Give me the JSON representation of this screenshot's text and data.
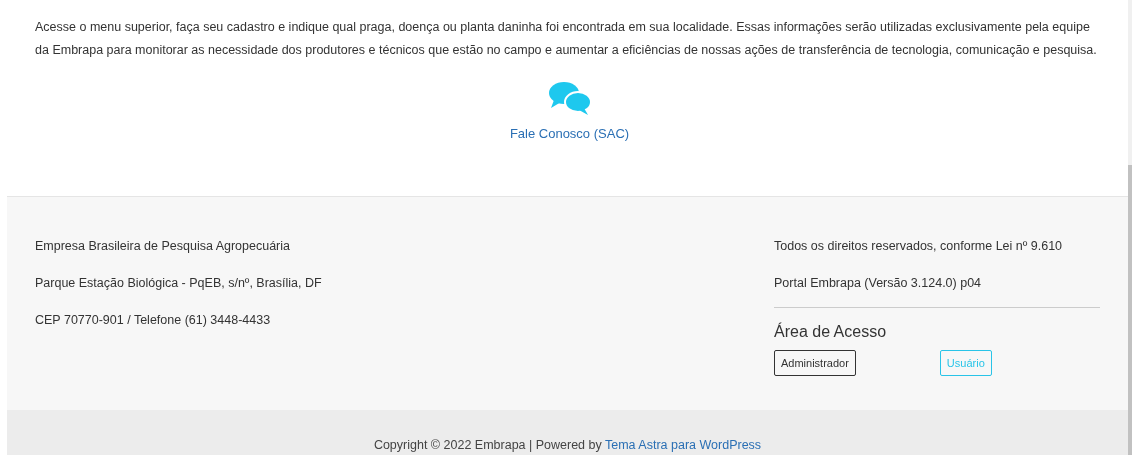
{
  "intro": {
    "paragraph": "Acesse o menu superior, faça seu cadastro e indique qual praga, doença ou planta daninha foi encontrada em sua localidade. Essas informações serão utilizadas exclusivamente pela equipe da Embrapa para monitorar as necessidade dos produtores e técnicos que estão no campo e aumentar a eficiências de nossas ações de transferência de tecnologia, comunicação e pesquisa.",
    "contact_link": "Fale Conosco (SAC)"
  },
  "footer": {
    "left_lines": [
      "Empresa Brasileira de Pesquisa Agropecuária",
      "Parque Estação Biológica - PqEB, s/nº, Brasília, DF",
      "CEP 70770-901 / Telefone (61) 3448-4433"
    ],
    "right_lines": [
      "Todos os direitos reservados, conforme Lei nº 9.610",
      "Portal Embrapa (Versão 3.124.0) p04"
    ],
    "access_title": "Área de Acesso",
    "access_buttons": [
      {
        "label": "Administrador",
        "kind": "dark"
      },
      {
        "label": "Usuário",
        "kind": "cyan"
      }
    ]
  },
  "copyright": {
    "text": "Copyright © 2022 Embrapa | Powered by ",
    "link": "Tema Astra para WordPress"
  }
}
